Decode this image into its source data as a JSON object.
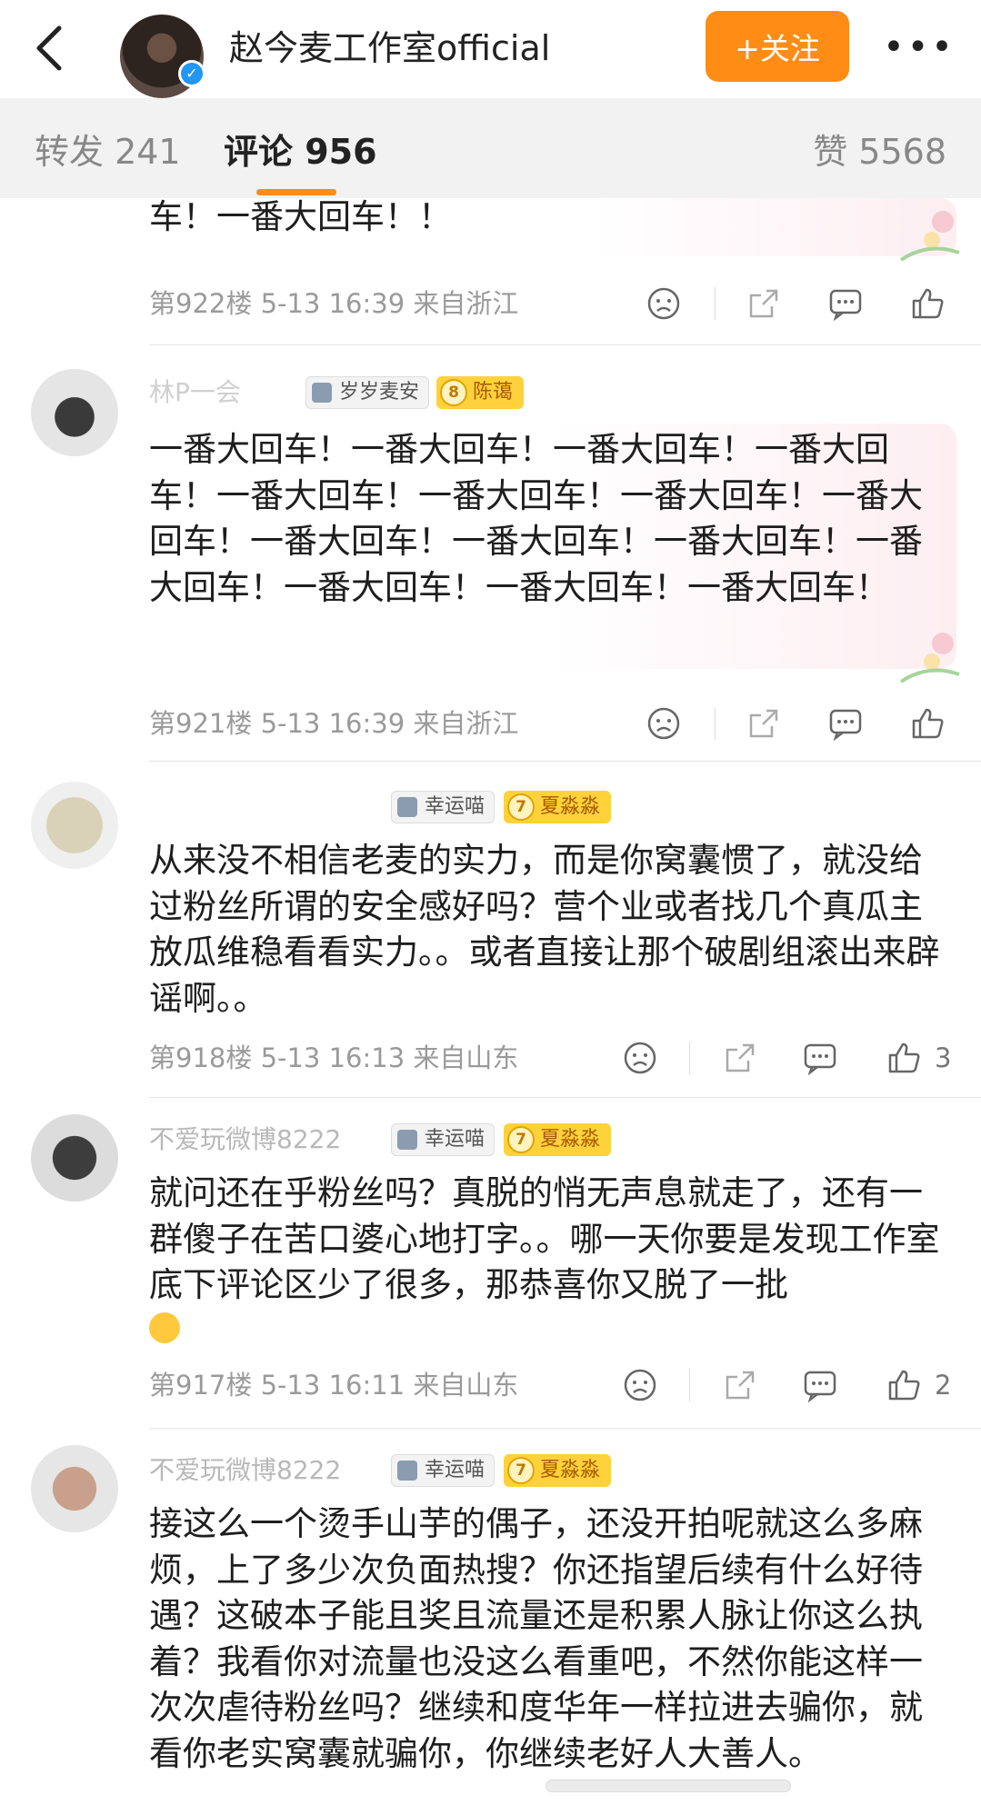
{
  "header": {
    "title": "赵今麦工作室official",
    "follow_label": "+关注",
    "more_label": "•••"
  },
  "tabs": {
    "repost": "转发 241",
    "comment": "评论 956",
    "like": "赞 5568"
  },
  "comments": [
    {
      "text": "车！一番大回车！！",
      "meta": "第922楼 5-13 16:39 来自浙江",
      "likes": ""
    },
    {
      "username": "林P一会",
      "fan_badge": "岁岁麦安",
      "level": "8",
      "level_label": "陈蔼",
      "text": "一番大回车！一番大回车！一番大回车！一番大回车！一番大回车！一番大回车！一番大回车！一番大回车！一番大回车！一番大回车！一番大回车！一番大回车！一番大回车！一番大回车！一番大回车！",
      "meta": "第921楼 5-13 16:39 来自浙江",
      "likes": ""
    },
    {
      "username": "",
      "fan_badge": "幸运喵",
      "level": "7",
      "level_label": "夏淼淼",
      "text": "从来没不相信老麦的实力，而是你窝囊惯了，就没给过粉丝所谓的安全感好吗？营个业或者找几个真瓜主放瓜维稳看看实力。。或者直接让那个破剧组滚出来辟谣啊。。",
      "meta": "第918楼 5-13 16:13 来自山东",
      "likes": "3"
    },
    {
      "username": "不爱玩微博8222",
      "fan_badge": "幸运喵",
      "level": "7",
      "level_label": "夏淼淼",
      "text": "就问还在乎粉丝吗？真脱的悄无声息就走了，还有一群傻子在苦口婆心地打字。。哪一天你要是发现工作室底下评论区少了很多，那恭喜你又脱了一批",
      "meta": "第917楼 5-13 16:11 来自山东",
      "likes": "2"
    },
    {
      "username": "不爱玩微博8222",
      "fan_badge": "幸运喵",
      "level": "7",
      "level_label": "夏淼淼",
      "text": "接这么一个烫手山芋的偶子，还没开拍呢就这么多麻烦，上了多少次负面热搜？你还指望后续有什么好待遇？这破本子能且奖且流量还是积累人脉让你这么执着？我看你对流量也没这么看重吧，不然你能这样一次次虐待粉丝吗？继续和度华年一样拉进去骗你，就看你老实窝囊就骗你，你继续老好人大善人。"
    }
  ],
  "colors": {
    "accent": "#ff8c14",
    "level_badge": "#ffd23c",
    "meta_text": "#9a9a9a"
  },
  "icons": [
    "back-arrow-icon",
    "verified-icon",
    "dislike-face-icon",
    "share-icon",
    "comment-icon",
    "like-thumb-icon"
  ]
}
